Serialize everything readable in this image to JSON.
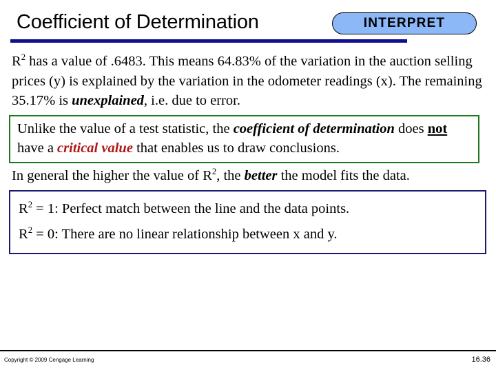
{
  "slide": {
    "title": "Coefficient of Determination",
    "badge_label": "INTERPRET",
    "accent_rule_color": "#10108C",
    "badge_fill_color": "#8CB8F8",
    "green_box_color": "#1F7A1F",
    "navy_box_color": "#1A1A6E",
    "highlight_red": "#B01818"
  },
  "body": {
    "intro": {
      "seg1": "R",
      "sup1": "2",
      "seg2": " has a value of .6483. This means 64.83% of the variation in the auction selling prices (y) is explained by the variation in the odometer readings (x). The remaining 35.17% is ",
      "emph_unexplained": "unexplained",
      "seg3": ", i.e. due to error."
    },
    "green_box": {
      "seg1": "Unlike the value of a test statistic, the ",
      "emph_coefficient": "coefficient of determination",
      "seg2": " does ",
      "emph_not": "not",
      "seg3": " have a ",
      "emph_critical_value": "critical value",
      "seg4": " that enables us to draw conclusions."
    },
    "general": {
      "seg1": "In general the higher the value of R",
      "sup1": "2",
      "seg2": ", the ",
      "emph_better": "better",
      "seg3": " the model fits the data."
    },
    "navy_box": {
      "line1": {
        "seg1": "R",
        "sup1": "2",
        "seg2": " = 1: Perfect match between the line and the data points."
      },
      "line2": {
        "seg1": "R",
        "sup1": "2",
        "seg2": " = 0: There are no linear relationship between x and y."
      }
    }
  },
  "footer": {
    "copyright": "Copyright © 2009 Cengage Learning",
    "page_number": "16.36"
  }
}
